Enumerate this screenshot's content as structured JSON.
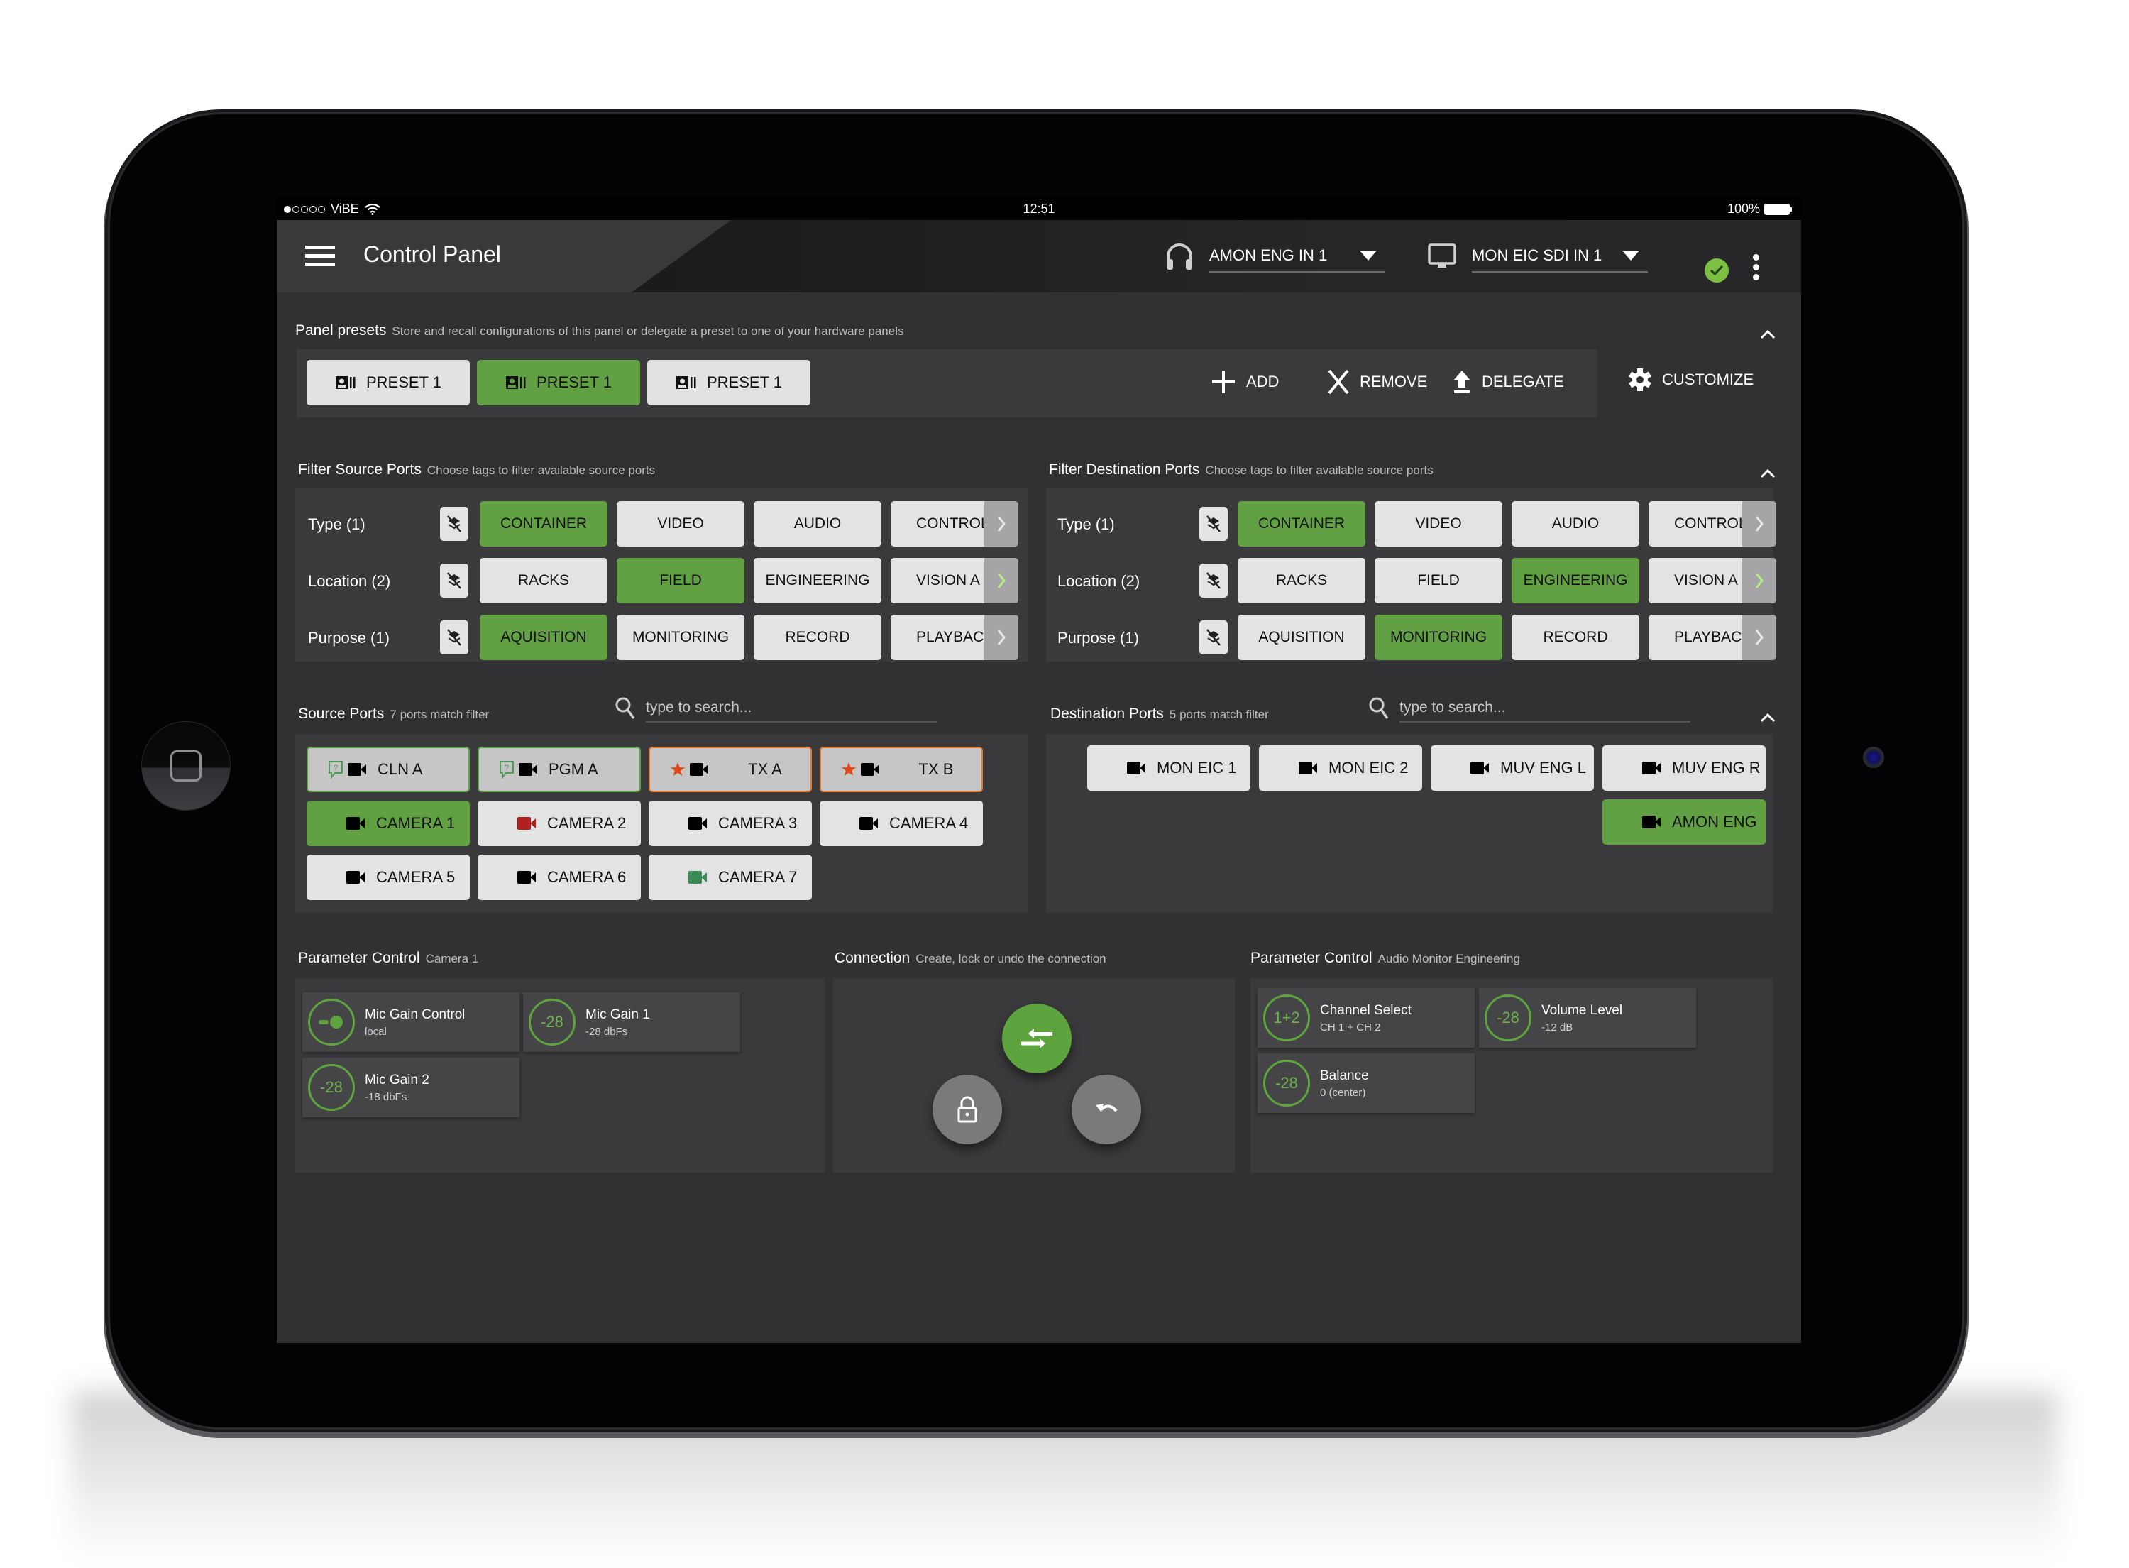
{
  "status_bar": {
    "carrier": "ViBE",
    "signal_dots_filled": 1,
    "signal_dots_total": 5,
    "time": "12:51",
    "battery": "100%"
  },
  "app_bar": {
    "title": "Control Panel",
    "audio_monitor": {
      "icon": "headphones-icon",
      "value": "AMON ENG IN 1"
    },
    "video_monitor": {
      "icon": "monitor-icon",
      "value": "MON EIC SDI IN 1"
    },
    "status_icon": "check-circle-icon",
    "status_color": "#7cc043"
  },
  "presets": {
    "label": "Panel presets",
    "description": "Store and recall configurations of this panel or delegate a preset to one of your hardware panels",
    "items": [
      {
        "label": "PRESET 1",
        "active": false
      },
      {
        "label": "PRESET 1",
        "active": true
      },
      {
        "label": "PRESET 1",
        "active": false
      }
    ],
    "actions": {
      "add": "ADD",
      "remove": "REMOVE",
      "delegate": "DELEGATE",
      "customize": "CUSTOMIZE"
    }
  },
  "filter_source": {
    "label": "Filter Source Ports",
    "description": "Choose tags to filter available source ports",
    "rows": [
      {
        "label": "Type (1)",
        "tags": [
          {
            "label": "CONTAINER",
            "active": true
          },
          {
            "label": "VIDEO",
            "active": false
          },
          {
            "label": "AUDIO",
            "active": false
          },
          {
            "label": "CONTROL",
            "active": false,
            "more": true
          }
        ]
      },
      {
        "label": "Location (2)",
        "tags": [
          {
            "label": "RACKS",
            "active": false
          },
          {
            "label": "FIELD",
            "active": true
          },
          {
            "label": "ENGINEERING",
            "active": false
          },
          {
            "label": "VISION A",
            "active": false,
            "more": true
          }
        ]
      },
      {
        "label": "Purpose (1)",
        "tags": [
          {
            "label": "AQUISITION",
            "active": true
          },
          {
            "label": "MONITORING",
            "active": false
          },
          {
            "label": "RECORD",
            "active": false
          },
          {
            "label": "PLAYBACK",
            "active": false,
            "more": true
          }
        ]
      }
    ]
  },
  "filter_destination": {
    "label": "Filter Destination Ports",
    "description": "Choose tags to filter available source ports",
    "rows": [
      {
        "label": "Type (1)",
        "tags": [
          {
            "label": "CONTAINER",
            "active": true
          },
          {
            "label": "VIDEO",
            "active": false
          },
          {
            "label": "AUDIO",
            "active": false
          },
          {
            "label": "CONTROL",
            "active": false,
            "more": true
          }
        ]
      },
      {
        "label": "Location (2)",
        "tags": [
          {
            "label": "RACKS",
            "active": false
          },
          {
            "label": "FIELD",
            "active": false
          },
          {
            "label": "ENGINEERING",
            "active": true
          },
          {
            "label": "VISION A",
            "active": false,
            "more": true
          }
        ]
      },
      {
        "label": "Purpose (1)",
        "tags": [
          {
            "label": "AQUISITION",
            "active": false
          },
          {
            "label": "MONITORING",
            "active": true
          },
          {
            "label": "RECORD",
            "active": false
          },
          {
            "label": "PLAYBACK",
            "active": false,
            "more": true
          }
        ]
      }
    ]
  },
  "source_ports": {
    "label": "Source Ports",
    "count_text": "7 ports match filter",
    "search_placeholder": "type to search...",
    "ports": [
      {
        "label": "CLN A",
        "badge": "help-bubble-icon",
        "style": "special-green",
        "icon_color": "#000000"
      },
      {
        "label": "PGM A",
        "badge": "help-bubble-icon",
        "style": "special-green",
        "icon_color": "#000000"
      },
      {
        "label": "TX A",
        "badge": "star-icon",
        "style": "special-orange",
        "icon_color": "#000000"
      },
      {
        "label": "TX B",
        "badge": "star-icon",
        "style": "special-orange",
        "icon_color": "#000000"
      },
      {
        "label": "CAMERA 1",
        "style": "active",
        "icon_color": "#000000"
      },
      {
        "label": "CAMERA 2",
        "style": "normal",
        "icon_color": "#b01f1f"
      },
      {
        "label": "CAMERA 3",
        "style": "normal",
        "icon_color": "#000000"
      },
      {
        "label": "CAMERA 4",
        "style": "normal",
        "icon_color": "#000000"
      },
      {
        "label": "CAMERA 5",
        "style": "normal",
        "icon_color": "#000000"
      },
      {
        "label": "CAMERA 6",
        "style": "normal",
        "icon_color": "#000000"
      },
      {
        "label": "CAMERA 7",
        "style": "normal",
        "icon_color": "#3a8a55"
      }
    ]
  },
  "destination_ports": {
    "label": "Destination Ports",
    "count_text": "5 ports match filter",
    "search_placeholder": "type to search...",
    "ports": [
      {
        "label": "MON EIC 1",
        "style": "normal"
      },
      {
        "label": "MON EIC 2",
        "style": "normal"
      },
      {
        "label": "MUV ENG L",
        "style": "normal"
      },
      {
        "label": "MUV ENG R",
        "style": "normal"
      },
      {
        "label": "AMON ENG",
        "style": "active"
      }
    ]
  },
  "param_source": {
    "label": "Parameter Control",
    "context": "Camera 1",
    "tiles": [
      {
        "knob": "toggle-icon",
        "name": "Mic Gain Control",
        "value": "local"
      },
      {
        "knob": "-28",
        "name": "Mic Gain 1",
        "value": "-28 dbFs"
      },
      {
        "knob": "-28",
        "name": "Mic Gain 2",
        "value": "-18 dbFs"
      }
    ]
  },
  "connection": {
    "label": "Connection",
    "description": "Create, lock or undo the connection",
    "buttons": {
      "connect": "connect-arrows-icon",
      "lock": "lock-icon",
      "undo": "undo-icon"
    }
  },
  "param_destination": {
    "label": "Parameter Control",
    "context": "Audio Monitor Engineering",
    "tiles": [
      {
        "knob": "1+2",
        "name": "Channel Select",
        "value": "CH 1 + CH 2"
      },
      {
        "knob": "-28",
        "name": "Volume Level",
        "value": "-12 dB"
      },
      {
        "knob": "-28",
        "name": "Balance",
        "value": "0 (center)"
      }
    ]
  },
  "colors": {
    "accent_green": "#62a044",
    "warning_orange": "#e77b2c",
    "background": "#313033",
    "panel": "#3a393c"
  }
}
